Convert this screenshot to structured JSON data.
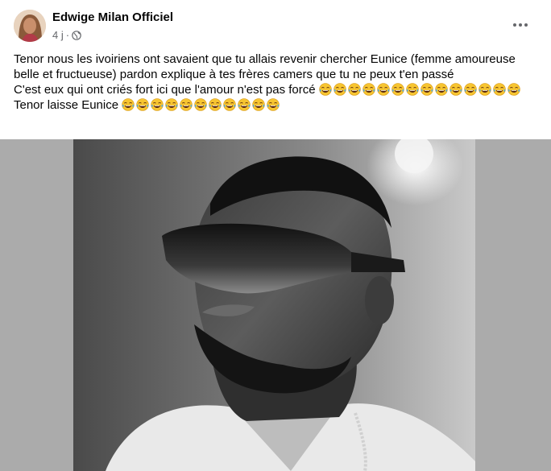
{
  "post": {
    "author": "Edwige Milan Officiel",
    "time": "4 j",
    "separator": "·",
    "privacy_icon": "globe-icon",
    "more_icon": "more-horizontal-icon",
    "lines": [
      {
        "text": "Tenor nous les ivoiriens ont savaient que tu allais revenir chercher Eunice (femme amoureuse belle et fructueuse) pardon explique à tes frères camers que tu ne peux t'en passé",
        "emoji_count": 0
      },
      {
        "text": "C'est eux qui ont criés fort ici que l'amour n'est pas forcé ",
        "emoji_count": 14
      },
      {
        "text": "Tenor laisse Eunice ",
        "emoji_count": 11
      }
    ],
    "emoji_icon": "face-with-tears-of-joy-icon",
    "photo_description_icon": "portrait-photo"
  }
}
